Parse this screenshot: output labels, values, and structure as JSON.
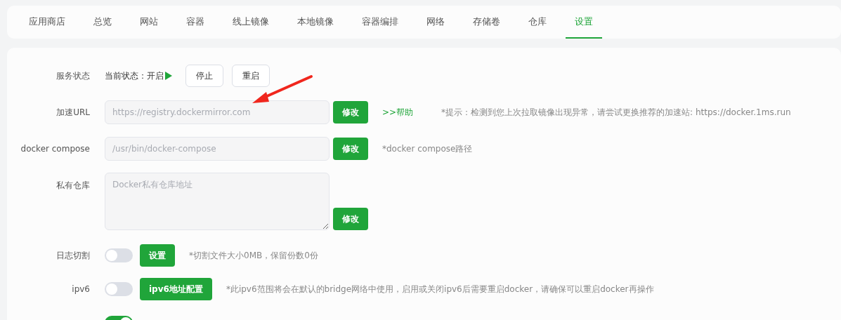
{
  "tabs": [
    {
      "label": "应用商店",
      "selected": false
    },
    {
      "label": "总览",
      "selected": false
    },
    {
      "label": "网站",
      "selected": false
    },
    {
      "label": "容器",
      "selected": false
    },
    {
      "label": "线上镜像",
      "selected": false
    },
    {
      "label": "本地镜像",
      "selected": false
    },
    {
      "label": "容器编排",
      "selected": false
    },
    {
      "label": "网络",
      "selected": false
    },
    {
      "label": "存储卷",
      "selected": false
    },
    {
      "label": "仓库",
      "selected": false
    },
    {
      "label": "设置",
      "selected": true
    }
  ],
  "rows": [
    {
      "kind": "status",
      "label": "服务状态",
      "prefix": "当前状态：",
      "value": "开启",
      "running": true,
      "buttons": [
        "停止",
        "重启"
      ]
    },
    {
      "kind": "input",
      "label": "加速URL",
      "placeholder": "https://registry.dockermirror.com",
      "button": "修改",
      "link": ">>帮助",
      "hint": "*提示：检测到您上次拉取镜像出现异常，请尝试更换推荐的加速站: https://docker.1ms.run"
    },
    {
      "kind": "input",
      "label": "docker compose",
      "placeholder": "/usr/bin/docker-compose",
      "button": "修改",
      "hint": "*docker compose路径"
    },
    {
      "kind": "textarea",
      "label": "私有仓库",
      "placeholder": "Docker私有仓库地址",
      "button": "修改"
    },
    {
      "kind": "toggle",
      "label": "日志切割",
      "on": false,
      "button": "设置",
      "hint": "*切割文件大小0MB，保留份数0份"
    },
    {
      "kind": "toggle",
      "label": "ipv6",
      "on": false,
      "button": "ipv6地址配置",
      "hint": "*此ipv6范围将会在默认的bridge网络中使用，启用或关闭ipv6后需要重启docker，请确保可以重启docker再操作"
    },
    {
      "kind": "toggle",
      "on": true
    }
  ]
}
